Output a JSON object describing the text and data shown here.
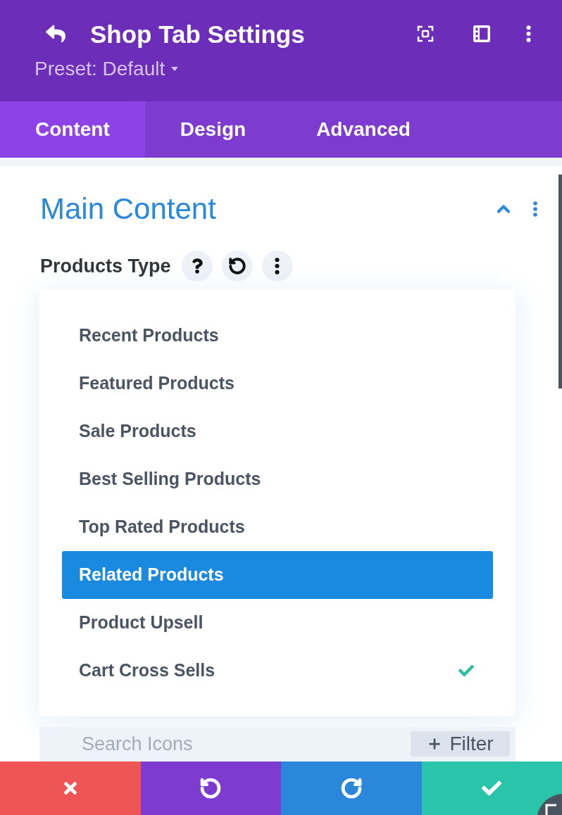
{
  "header": {
    "title": "Shop Tab Settings",
    "preset": "Preset: Default"
  },
  "tabs": [
    {
      "label": "Content",
      "selected": true
    },
    {
      "label": "Design",
      "selected": false
    },
    {
      "label": "Advanced",
      "selected": false
    }
  ],
  "section": {
    "title": "Main Content",
    "expanded": true
  },
  "field": {
    "label": "Products Type",
    "options": [
      {
        "label": "Recent Products",
        "highlighted": false,
        "checked": false
      },
      {
        "label": "Featured Products",
        "highlighted": false,
        "checked": false
      },
      {
        "label": "Sale Products",
        "highlighted": false,
        "checked": false
      },
      {
        "label": "Best Selling Products",
        "highlighted": false,
        "checked": false
      },
      {
        "label": "Top Rated Products",
        "highlighted": false,
        "checked": false
      },
      {
        "label": "Related Products",
        "highlighted": true,
        "checked": false
      },
      {
        "label": "Product Upsell",
        "highlighted": false,
        "checked": false
      },
      {
        "label": "Cart Cross Sells",
        "highlighted": false,
        "checked": true
      }
    ]
  },
  "search": {
    "placeholder": "Search Icons"
  },
  "filter_button": {
    "label": "Filter"
  },
  "actions": [
    {
      "kind": "discard",
      "color": "#ef5555"
    },
    {
      "kind": "undo",
      "color": "#7e3bd0"
    },
    {
      "kind": "redo",
      "color": "#2b87da"
    },
    {
      "kind": "save",
      "color": "#29c4a9"
    }
  ]
}
